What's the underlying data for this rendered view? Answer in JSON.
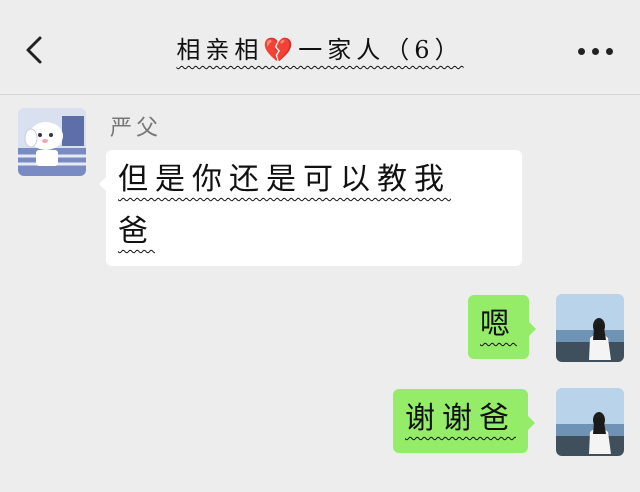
{
  "header": {
    "title": "相亲相💔一家人（6）",
    "back_icon": "chevron-left-icon",
    "more_icon": "more-dots-icon"
  },
  "messages": [
    {
      "direction": "incoming",
      "sender": "严父",
      "text_line1": "但是你还是可以教我",
      "text_line2": "爸",
      "avatar": "cartoon-dog-avatar"
    },
    {
      "direction": "outgoing",
      "text": "嗯",
      "avatar": "girl-by-sea-avatar"
    },
    {
      "direction": "outgoing",
      "text": "谢谢爸",
      "avatar": "girl-by-sea-avatar"
    }
  ],
  "colors": {
    "background": "#ededed",
    "incoming_bubble": "#ffffff",
    "outgoing_bubble": "#95ec69"
  }
}
